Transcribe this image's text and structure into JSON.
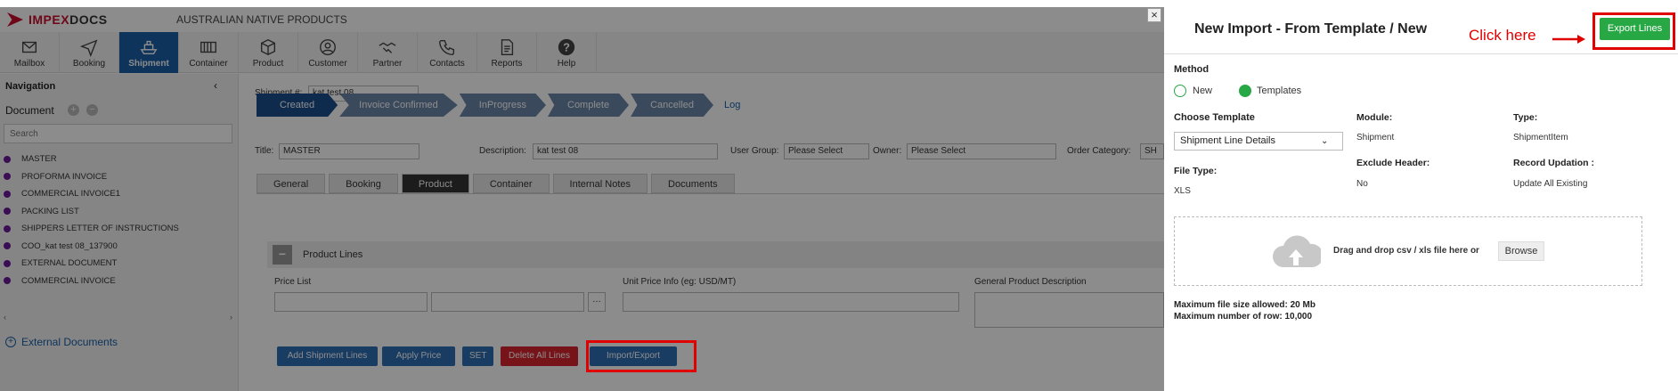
{
  "brand": {
    "name_red": "IMPEX",
    "name_dark": "DOCS",
    "company": "AUSTRALIAN NATIVE PRODUCTS"
  },
  "ribbon": [
    {
      "label": "Mailbox",
      "icon": "mailbox-icon"
    },
    {
      "label": "Booking",
      "icon": "paper-plane-icon"
    },
    {
      "label": "Shipment",
      "icon": "ship-icon"
    },
    {
      "label": "Container",
      "icon": "container-icon"
    },
    {
      "label": "Product",
      "icon": "box-icon"
    },
    {
      "label": "Customer",
      "icon": "user-icon"
    },
    {
      "label": "Partner",
      "icon": "handshake-icon"
    },
    {
      "label": "Contacts",
      "icon": "phone-icon"
    },
    {
      "label": "Reports",
      "icon": "report-icon"
    },
    {
      "label": "Help",
      "icon": "help-icon"
    }
  ],
  "sidebar": {
    "title": "Navigation",
    "collapse": "‹",
    "document_label": "Document",
    "add": "+",
    "remove": "−",
    "search_placeholder": "Search",
    "items": [
      "MASTER",
      "PROFORMA INVOICE",
      "COMMERCIAL INVOICE1",
      "PACKING LIST",
      "SHIPPERS LETTER OF INSTRUCTIONS",
      "COO_kat test 08_137900",
      "EXTERNAL DOCUMENT",
      "COMMERCIAL INVOICE"
    ],
    "scroll_left": "‹",
    "scroll_right": "›",
    "external_documents": "External Documents",
    "external_plus": "+"
  },
  "main": {
    "shipment_label": "Shipment #:",
    "shipment_value": "kat test 08",
    "steps": [
      "Created",
      "Invoice Confirmed",
      "InProgress",
      "Complete",
      "Cancelled"
    ],
    "log": "Log",
    "title_label": "Title:",
    "title_value": "MASTER",
    "description_label": "Description:",
    "description_value": "kat test 08",
    "user_group_label": "User Group:",
    "user_group_value": "Please Select",
    "owner_label": "Owner:",
    "owner_value": "Please Select",
    "order_category_label": "Order Category:",
    "order_category_value": "SH",
    "tabs": [
      "General",
      "Booking",
      "Product",
      "Container",
      "Internal Notes",
      "Documents"
    ],
    "product_lines_title": "Product Lines",
    "product_lines_toggle": "−",
    "price_list_label": "Price List",
    "price_list_more": "…",
    "unit_price_label": "Unit Price Info (eg: USD/MT)",
    "general_desc_label": "General Product Description",
    "buttons": {
      "add": "Add Shipment Lines",
      "apply": "Apply Price List",
      "set": "SET",
      "delete": "Delete All Lines",
      "import_export": "Import/Export Lines"
    }
  },
  "panel": {
    "close": "×",
    "title": "New Import - From Template / New",
    "click_here": "Click here",
    "export_lines": "Export Lines",
    "method_label": "Method",
    "method_new": "New",
    "method_templates": "Templates",
    "choose_template_label": "Choose Template",
    "choose_template_value": "Shipment Line Details",
    "chevron": "⌄",
    "module_label": "Module:",
    "module_value": "Shipment",
    "type_label": "Type:",
    "type_value": "ShipmentItem",
    "file_type_label": "File Type:",
    "file_type_value": "XLS",
    "exclude_header_label": "Exclude Header:",
    "exclude_header_value": "No",
    "record_updation_label": "Record Updation :",
    "record_updation_value": "Update All Existing",
    "drop_text": "Drag and drop csv / xls file here or",
    "browse": "Browse",
    "max_size": "Maximum file size allowed: 20 Mb",
    "max_rows": "Maximum number of row: 10,000"
  },
  "colors": {
    "accent_blue": "#1a5fa8",
    "success_green": "#28a745",
    "highlight_red": "#e00000",
    "brand_red": "#c8102e"
  }
}
